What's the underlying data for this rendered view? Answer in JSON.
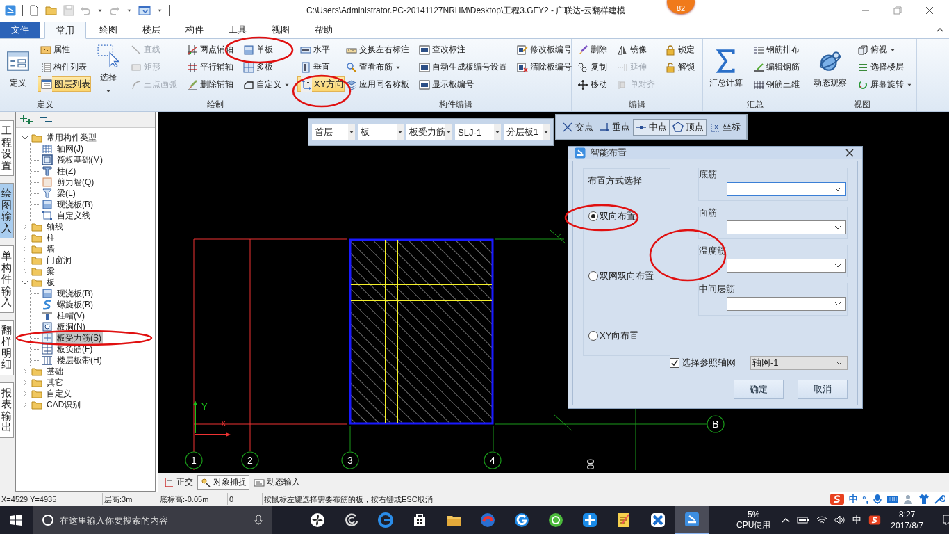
{
  "window": {
    "title": "C:\\Users\\Administrator.PC-20141127NRHM\\Desktop\\工程3.GFY2 - 广联达-云翻样建模",
    "badge": "82"
  },
  "menu_tabs": [
    {
      "label": "文件",
      "kind": "file",
      "selected": false
    },
    {
      "label": "常用",
      "kind": "tab",
      "selected": true
    },
    {
      "label": "绘图",
      "kind": "tab",
      "selected": false
    },
    {
      "label": "楼层",
      "kind": "tab",
      "selected": false
    },
    {
      "label": "构件",
      "kind": "tab",
      "selected": false
    },
    {
      "label": "工具",
      "kind": "tab",
      "selected": false
    },
    {
      "label": "视图",
      "kind": "tab",
      "selected": false
    },
    {
      "label": "帮助",
      "kind": "tab",
      "selected": false
    }
  ],
  "ribbon": {
    "groups": [
      {
        "label": "定义",
        "columns": [
          [
            {
              "label": "定义",
              "disabled": false,
              "selected": false,
              "dropdown": false
            }
          ],
          [
            {
              "label": "属性",
              "disabled": false,
              "selected": false,
              "dropdown": false
            },
            {
              "label": "构件列表",
              "disabled": false,
              "selected": false,
              "dropdown": false
            },
            {
              "label": "图层列表",
              "disabled": false,
              "selected": true,
              "dropdown": false
            }
          ]
        ]
      },
      {
        "label": "绘制",
        "columns": [
          [
            {
              "label": "选择",
              "disabled": false,
              "selected": false,
              "dropdown": true
            }
          ],
          [
            {
              "label": "直线",
              "disabled": true,
              "selected": false,
              "dropdown": false
            },
            {
              "label": "矩形",
              "disabled": true,
              "selected": false,
              "dropdown": false
            },
            {
              "label": "三点画弧",
              "disabled": true,
              "selected": false,
              "dropdown": false
            }
          ],
          [
            {
              "label": "两点辅轴",
              "disabled": false,
              "selected": false,
              "dropdown": false
            },
            {
              "label": "平行辅轴",
              "disabled": false,
              "selected": false,
              "dropdown": false
            },
            {
              "label": "删除辅轴",
              "disabled": false,
              "selected": false,
              "dropdown": false
            }
          ],
          [
            {
              "label": "单板",
              "disabled": false,
              "selected": false,
              "dropdown": false
            },
            {
              "label": "多板",
              "disabled": false,
              "selected": false,
              "dropdown": false
            },
            {
              "label": "自定义",
              "disabled": false,
              "selected": false,
              "dropdown": true
            }
          ],
          [
            {
              "label": "水平",
              "disabled": false,
              "selected": false,
              "dropdown": false
            },
            {
              "label": "垂直",
              "disabled": false,
              "selected": false,
              "dropdown": false
            },
            {
              "label": "XY方向",
              "disabled": false,
              "selected": true,
              "dropdown": false
            }
          ]
        ]
      },
      {
        "label": "构件编辑",
        "columns": [
          [
            {
              "label": "交换左右标注",
              "disabled": false,
              "selected": false,
              "dropdown": false
            },
            {
              "label": "查看布筋",
              "disabled": false,
              "selected": false,
              "dropdown": true
            },
            {
              "label": "应用同名称板",
              "disabled": false,
              "selected": false,
              "dropdown": false
            }
          ],
          [
            {
              "label": "查改标注",
              "disabled": false,
              "selected": false,
              "dropdown": false
            },
            {
              "label": "自动生成板编号设置",
              "disabled": false,
              "selected": false,
              "dropdown": false
            },
            {
              "label": "显示板编号",
              "disabled": false,
              "selected": false,
              "dropdown": false
            }
          ],
          [
            {
              "label": "修改板编号",
              "disabled": false,
              "selected": false,
              "dropdown": false
            },
            {
              "label": "清除板编号",
              "disabled": false,
              "selected": false,
              "dropdown": false
            }
          ]
        ]
      },
      {
        "label": "编辑",
        "columns": [
          [
            {
              "label": "删除",
              "disabled": false,
              "selected": false,
              "dropdown": false
            },
            {
              "label": "复制",
              "disabled": false,
              "selected": false,
              "dropdown": false
            },
            {
              "label": "移动",
              "disabled": false,
              "selected": false,
              "dropdown": false
            }
          ],
          [
            {
              "label": "镜像",
              "disabled": false,
              "selected": false,
              "dropdown": false
            },
            {
              "label": "延伸",
              "disabled": true,
              "selected": false,
              "dropdown": false
            },
            {
              "label": "单对齐",
              "disabled": true,
              "selected": false,
              "dropdown": false
            }
          ],
          [
            {
              "label": "锁定",
              "disabled": false,
              "selected": false,
              "dropdown": false
            },
            {
              "label": "解锁",
              "disabled": false,
              "selected": false,
              "dropdown": false
            }
          ]
        ]
      },
      {
        "label": "汇总",
        "columns": [
          [
            {
              "label": "汇总计算",
              "disabled": false,
              "selected": false,
              "dropdown": false
            }
          ],
          [
            {
              "label": "钢筋排布",
              "disabled": false,
              "selected": false,
              "dropdown": false
            },
            {
              "label": "编辑钢筋",
              "disabled": false,
              "selected": false,
              "dropdown": false
            },
            {
              "label": "钢筋三维",
              "disabled": false,
              "selected": false,
              "dropdown": false
            }
          ]
        ]
      },
      {
        "label": "视图",
        "columns": [
          [
            {
              "label": "动态观察",
              "disabled": false,
              "selected": false,
              "dropdown": false
            }
          ],
          [
            {
              "label": "俯视",
              "disabled": false,
              "selected": false,
              "dropdown": true
            },
            {
              "label": "选择楼层",
              "disabled": false,
              "selected": false,
              "dropdown": false
            },
            {
              "label": "屏幕旋转",
              "disabled": false,
              "selected": false,
              "dropdown": true
            }
          ]
        ]
      }
    ]
  },
  "side_tabs": [
    {
      "label": "工程设置",
      "selected": false
    },
    {
      "label": "绘图输入",
      "selected": true
    },
    {
      "label": "单构件输入",
      "selected": false
    },
    {
      "label": "翻样明细",
      "selected": false
    },
    {
      "label": "报表输出",
      "selected": false
    }
  ],
  "tree": {
    "items": [
      {
        "label": "常用构件类型",
        "expanded": true,
        "selected": false,
        "children": [
          {
            "label": "轴网(J)",
            "selected": false
          },
          {
            "label": "筏板基础(M)",
            "selected": false
          },
          {
            "label": "柱(Z)",
            "selected": false
          },
          {
            "label": "剪力墙(Q)",
            "selected": false
          },
          {
            "label": "梁(L)",
            "selected": false
          },
          {
            "label": "现浇板(B)",
            "selected": false
          },
          {
            "label": "自定义线",
            "selected": false
          }
        ]
      },
      {
        "label": "轴线",
        "expanded": false,
        "selected": false
      },
      {
        "label": "柱",
        "expanded": false,
        "selected": false
      },
      {
        "label": "墙",
        "expanded": false,
        "selected": false
      },
      {
        "label": "门窗洞",
        "expanded": false,
        "selected": false
      },
      {
        "label": "梁",
        "expanded": false,
        "selected": false
      },
      {
        "label": "板",
        "expanded": true,
        "selected": false,
        "children": [
          {
            "label": "现浇板(B)",
            "selected": false
          },
          {
            "label": "螺旋板(B)",
            "selected": false
          },
          {
            "label": "柱帽(V)",
            "selected": false
          },
          {
            "label": "板洞(N)",
            "selected": false
          },
          {
            "label": "板受力筋(S)",
            "selected": true
          },
          {
            "label": "板负筋(F)",
            "selected": false
          },
          {
            "label": "楼层板带(H)",
            "selected": false
          }
        ]
      },
      {
        "label": "基础",
        "expanded": false,
        "selected": false
      },
      {
        "label": "其它",
        "expanded": false,
        "selected": false
      },
      {
        "label": "自定义",
        "expanded": false,
        "selected": false
      },
      {
        "label": "CAD识别",
        "expanded": false,
        "selected": false
      }
    ]
  },
  "canvas": {
    "selectors": [
      "首层",
      "板",
      "板受力筋",
      "SLJ-1",
      "分层板1"
    ],
    "snaps": [
      {
        "label": "交点",
        "selected": false
      },
      {
        "label": "垂点",
        "selected": false
      },
      {
        "label": "中点",
        "selected": true
      },
      {
        "label": "顶点",
        "selected": true
      },
      {
        "label": "坐标",
        "selected": false
      }
    ],
    "axis_labels": [
      "1",
      "2",
      "3",
      "4",
      "B"
    ],
    "ucs": {
      "x": "X",
      "y": "Y"
    },
    "side_text": "00",
    "bottom_tools": [
      {
        "label": "正交",
        "selected": false
      },
      {
        "label": "对象捕捉",
        "selected": true
      },
      {
        "label": "动态输入",
        "selected": false
      }
    ]
  },
  "dialog": {
    "title": "智能布置",
    "group_title": "布置方式选择",
    "modes": [
      {
        "label": "双向布置",
        "selected": true
      },
      {
        "label": "双网双向布置",
        "selected": false
      },
      {
        "label": "XY向布置",
        "selected": false
      }
    ],
    "fields": [
      {
        "label": "底筋",
        "focused": true
      },
      {
        "label": "面筋",
        "focused": false
      },
      {
        "label": "温度筋",
        "focused": false
      },
      {
        "label": "中间层筋",
        "focused": false
      }
    ],
    "axis_check": {
      "label": "选择参照轴网",
      "checked": true,
      "value": "轴网-1"
    },
    "buttons": [
      "确定",
      "取消"
    ]
  },
  "status_bar": [
    "X=4529 Y=4935",
    "层高:3m",
    "底标高:-0.05m",
    "0",
    "按鼠标左键选择需要布筋的板，按右键或ESC取消"
  ],
  "ime": [
    "中",
    "°,"
  ],
  "taskbar": {
    "search_placeholder": "在这里输入你要搜索的内容",
    "apps": [
      {
        "selected": false
      },
      {
        "selected": false
      },
      {
        "selected": false
      },
      {
        "selected": false
      },
      {
        "selected": false
      },
      {
        "selected": false
      },
      {
        "selected": false
      },
      {
        "selected": false
      },
      {
        "selected": false
      },
      {
        "selected": false
      },
      {
        "selected": false
      },
      {
        "selected": true
      }
    ],
    "cpu_value": "5%",
    "cpu_label": "CPU使用",
    "ime": "中",
    "time": "8:27",
    "date": "2017/8/7"
  }
}
